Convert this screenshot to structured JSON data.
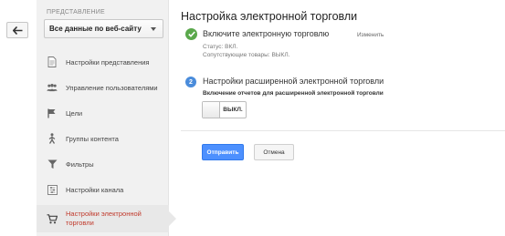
{
  "colors": {
    "accent_blue": "#4d90fe",
    "success_green": "#5aa84b",
    "active_red": "#c0392b",
    "sidebar_bg": "#f1f1f1"
  },
  "sidebar": {
    "section_label": "ПРЕДСТАВЛЕНИЕ",
    "view_select_value": "Все данные по веб-сайту",
    "items": [
      {
        "label": "Настройки представления",
        "icon": "document-icon"
      },
      {
        "label": "Управление пользователями",
        "icon": "users-icon"
      },
      {
        "label": "Цели",
        "icon": "flag-icon"
      },
      {
        "label": "Группы контента",
        "icon": "person-walk-icon"
      },
      {
        "label": "Фильтры",
        "icon": "filter-icon"
      },
      {
        "label": "Настройки канала",
        "icon": "channel-icon"
      },
      {
        "label": "Настройки электронной торговли",
        "icon": "cart-icon",
        "active": true
      }
    ]
  },
  "main": {
    "title": "Настройка электронной торговли",
    "step1": {
      "title": "Включите электронную торговлю",
      "edit_label": "Изменить",
      "status": "Статус: ВКЛ.",
      "related": "Сопутствующие товары: ВЫКЛ."
    },
    "step2": {
      "number": "2",
      "title": "Настройки расширенной электронной торговли",
      "subtitle": "Включение отчетов для расширенной электронной торговли",
      "toggle_state": "ВЫКЛ."
    },
    "buttons": {
      "submit": "Отправить",
      "cancel": "Отмена"
    }
  }
}
